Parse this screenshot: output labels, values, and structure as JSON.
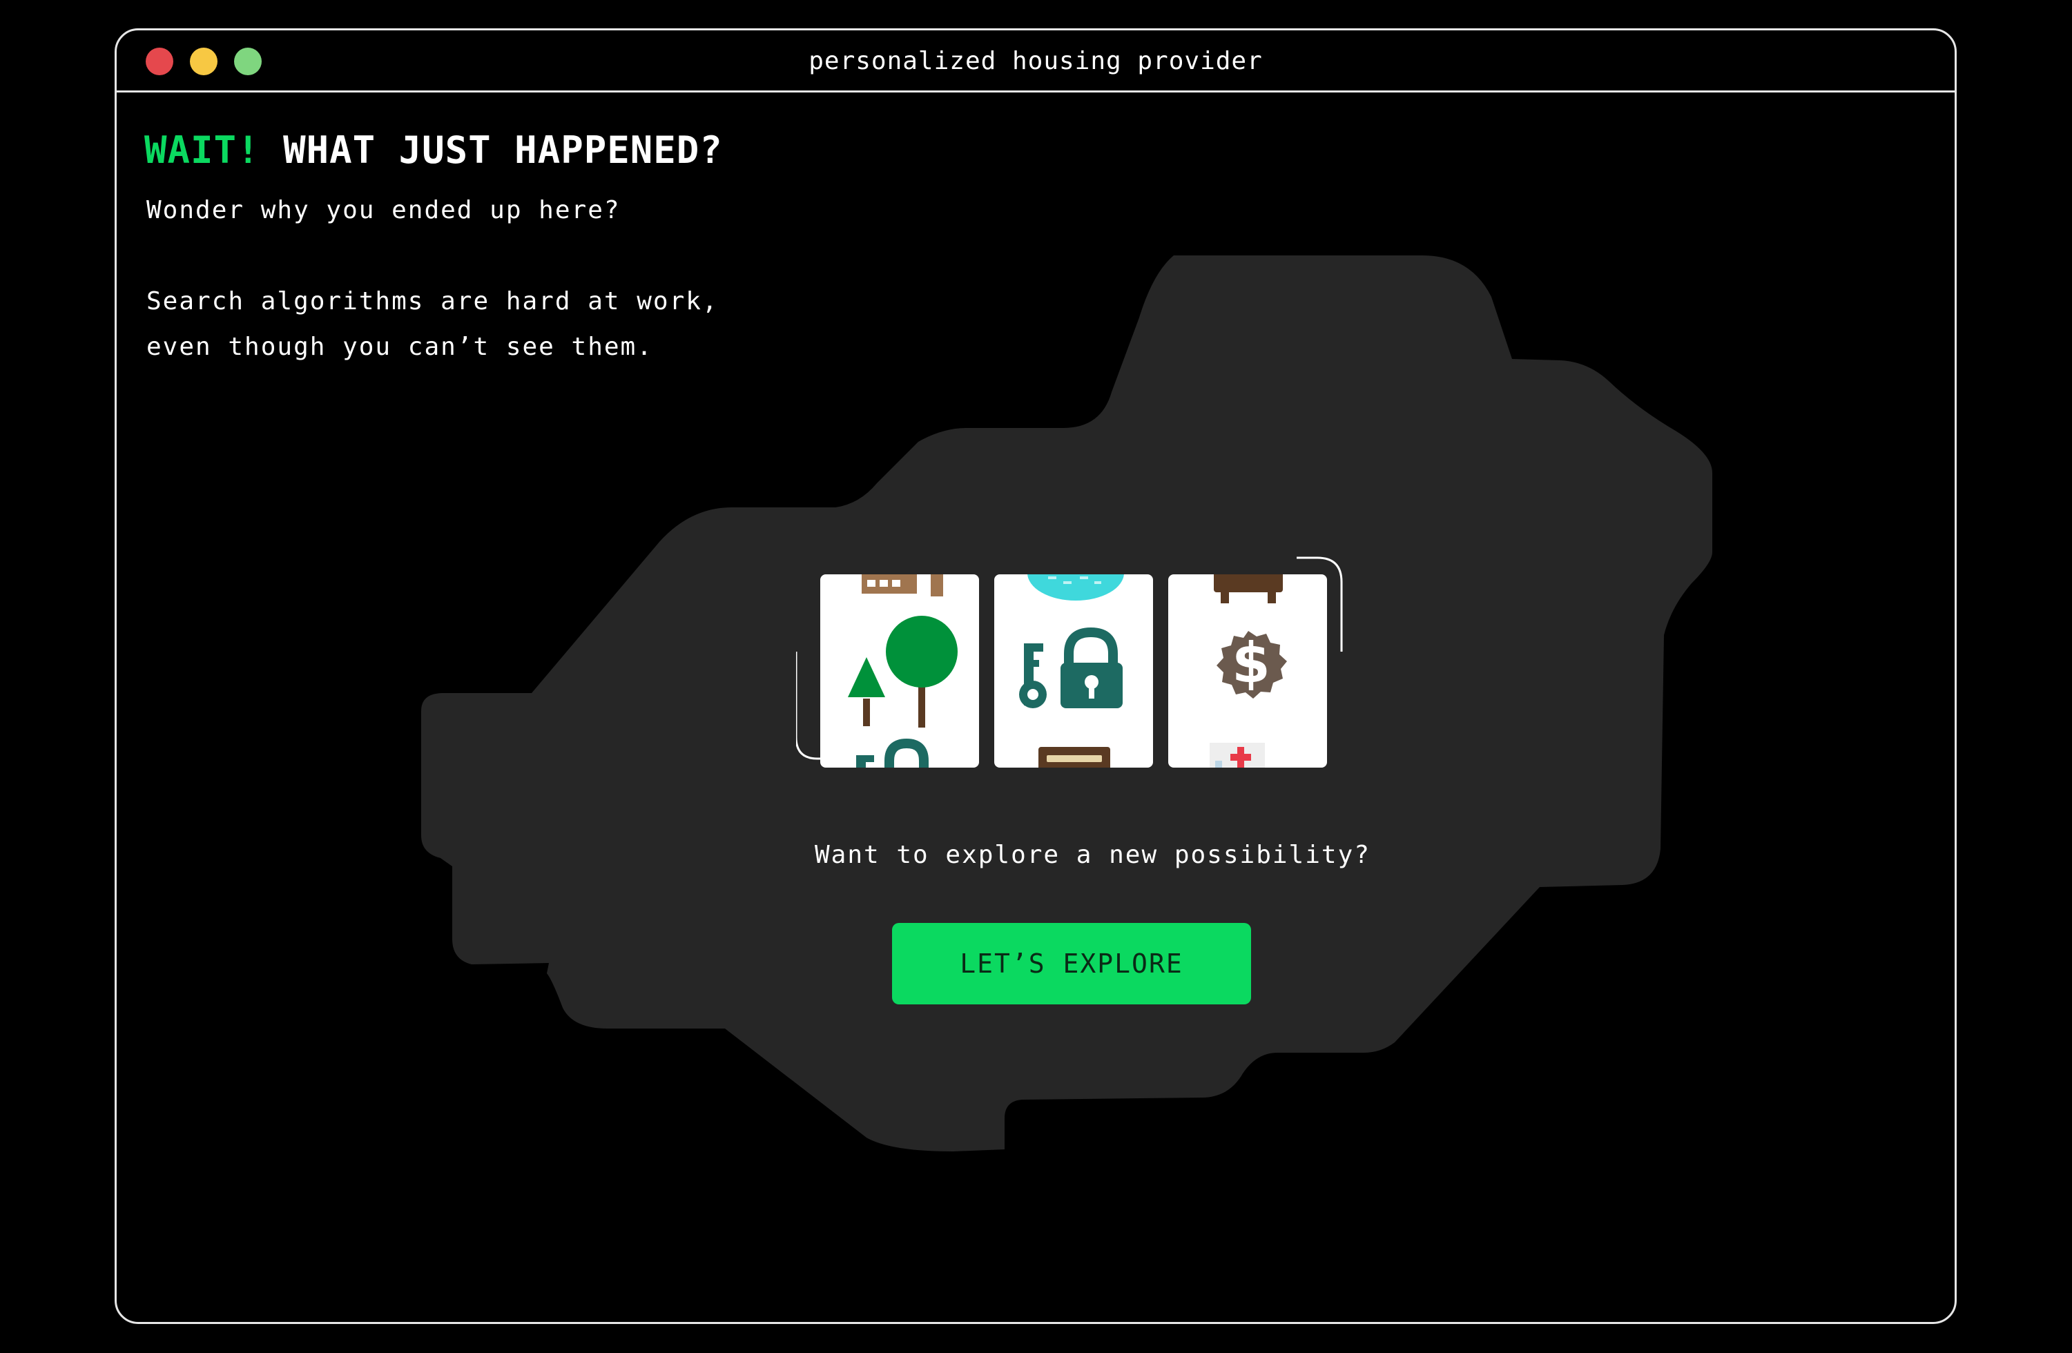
{
  "window": {
    "title": "personalized housing provider",
    "controls": [
      "close",
      "minimize",
      "maximize"
    ]
  },
  "headline": {
    "accent": "WAIT!",
    "text": "WHAT JUST HAPPENED?"
  },
  "intro": {
    "line1": "Wonder why you ended up here?",
    "line2": "Search algorithms are hard at work,",
    "line3": "even though you can’t see them."
  },
  "slot_machine": {
    "reels": [
      {
        "center_icon": "trees-icon",
        "top_icon": "building-icon",
        "bottom_icon": "key-lock-icon"
      },
      {
        "center_icon": "key-lock-icon",
        "top_icon": "pool-icon",
        "bottom_icon": "bench-icon"
      },
      {
        "center_icon": "dollar-badge-icon",
        "top_icon": "bed-icon",
        "bottom_icon": "hospital-icon"
      }
    ]
  },
  "prompt": "Want to explore a new possibility?",
  "cta_label": "LET’S EXPLORE",
  "colors": {
    "background": "#000000",
    "blob": "#262626",
    "accent": "#0bd960",
    "close": "#e5484d",
    "minimize": "#f7c843",
    "maximize": "#7fd67f"
  }
}
